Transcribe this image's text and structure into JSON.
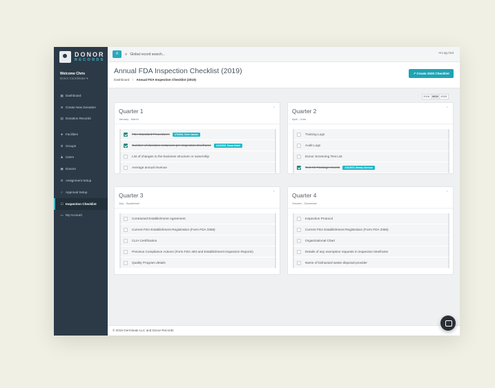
{
  "brand": {
    "line1": "DONOR",
    "line2": "RECORDS"
  },
  "user": {
    "welcome": "Welcome Chris",
    "role": "Donor Coordinator ▾"
  },
  "nav": {
    "group1": [
      {
        "icon": "dashboard-icon",
        "glyph": "▦",
        "label": "Dashboard"
      },
      {
        "icon": "plus-circle-icon",
        "glyph": "⊕",
        "label": "Create New Donation"
      },
      {
        "icon": "records-icon",
        "glyph": "▤",
        "label": "Donation Records"
      }
    ],
    "group2": [
      {
        "icon": "facilities-icon",
        "glyph": "♣",
        "label": "Facilities"
      },
      {
        "icon": "groups-icon",
        "glyph": "♛",
        "label": "Groups"
      },
      {
        "icon": "user-icon",
        "glyph": "♟",
        "label": "Users"
      },
      {
        "icon": "donors-icon",
        "glyph": "▣",
        "label": "Donors"
      },
      {
        "icon": "gear-icon",
        "glyph": "⚙",
        "label": "Assignment Setup"
      },
      {
        "icon": "check-icon",
        "glyph": "✓",
        "label": "Approval Setup"
      },
      {
        "icon": "checklist-icon",
        "glyph": "☑",
        "label": "Inspection Checklist",
        "active": true
      },
      {
        "icon": "account-icon",
        "glyph": "▭",
        "label": "My Account"
      }
    ]
  },
  "topbar": {
    "menu_glyph": "≡",
    "search_placeholder": "Global record search...",
    "logout": "⇥ Log Out"
  },
  "header": {
    "title": "Annual FDA Inspection Checklist (2019)",
    "breadcrumb_home": "Dashboard",
    "breadcrumb_sep": "/",
    "breadcrumb_current": "Annual FDA Inspection Checklist (2019)",
    "create_button": "↗ Create 2020 Checklist"
  },
  "years": [
    "2018",
    "2019",
    "2020"
  ],
  "active_year": "2019",
  "quarters": [
    {
      "title": "Quarter 1",
      "subtitle": "January - March",
      "items": [
        {
          "label": "FDA Standard Procedures",
          "done": true,
          "badge": "1/7/2019, Chris Jacobs"
        },
        {
          "label": "Number of donation instances per inspection timeframe",
          "done": true,
          "badge": "1/14/2019, Susan Noble"
        },
        {
          "label": "List of changes to the business structure or ownership",
          "done": false
        },
        {
          "label": "Average annual revenue",
          "done": false
        }
      ]
    },
    {
      "title": "Quarter 2",
      "subtitle": "April - June",
      "items": [
        {
          "label": "Training Logs",
          "done": false
        },
        {
          "label": "Audit Logs",
          "done": false
        },
        {
          "label": "Donor Screening Test List",
          "done": false
        },
        {
          "label": "Test Kit Package Inserts",
          "done": true,
          "badge": "1/21/2019, Wendy Johnson"
        }
      ]
    },
    {
      "title": "Quarter 3",
      "subtitle": "July - September",
      "items": [
        {
          "label": "Contracted Establishment Agreement",
          "done": false
        },
        {
          "label": "Current FDA Establishment Registration (Form FDA 3356)",
          "done": false
        },
        {
          "label": "CLIA Certification",
          "done": false
        },
        {
          "label": "Previous Compliance Actions (Form FDA 483 and Establishment Inspection Reports)",
          "done": false
        },
        {
          "label": "Quality Program details",
          "done": false
        }
      ]
    },
    {
      "title": "Quarter 4",
      "subtitle": "October - December",
      "items": [
        {
          "label": "Inspection Protocol",
          "done": false
        },
        {
          "label": "Current FDA Establishment Registration (Form FDA 3356)",
          "done": false
        },
        {
          "label": "Organizational Chart",
          "done": false
        },
        {
          "label": "Details of any exemption requests in inspection timeframe",
          "done": false
        },
        {
          "label": "Name of biohazard waste disposal provider",
          "done": false
        }
      ]
    }
  ],
  "footer": "© 2019 Germinate LLC and Donor Records",
  "colors": {
    "sidebar": "#2c3a47",
    "accent": "#1fa3b5",
    "checked": "#1f8a7a",
    "badge": "#20b8c8"
  }
}
